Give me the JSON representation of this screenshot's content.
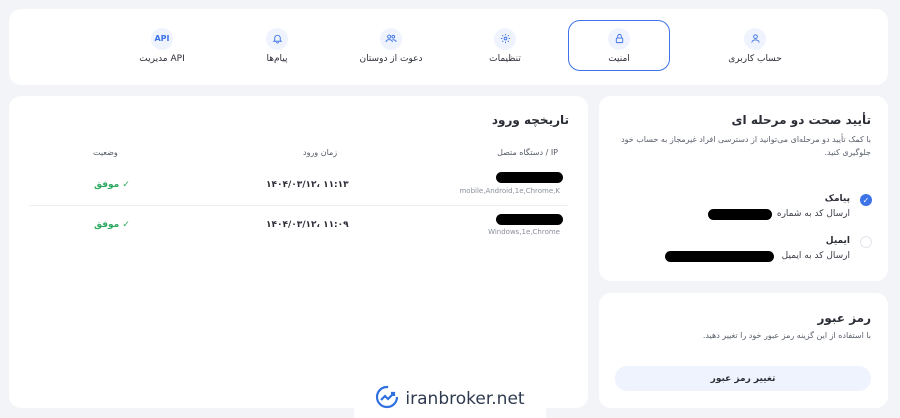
{
  "nav": {
    "tabs": [
      {
        "label": "حساب کاربری",
        "icon": "user-icon",
        "active": false
      },
      {
        "label": "امنیت",
        "icon": "lock-icon",
        "active": true
      },
      {
        "label": "تنظیمات",
        "icon": "gear-icon",
        "active": false
      },
      {
        "label": "دعوت از دوستان",
        "icon": "users-icon",
        "active": false
      },
      {
        "label": "پیام‌ها",
        "icon": "bell-icon",
        "active": false
      },
      {
        "label": "مدیریت API",
        "icon": "api-icon",
        "icon_text": "API",
        "active": false
      }
    ]
  },
  "history": {
    "title": "تاریخچه ورود",
    "columns": {
      "device": "دستگاه متصل / IP",
      "time": "زمان ورود",
      "status": "وضعیت"
    },
    "rows": [
      {
        "device": "mobile,Android,1e,Chrome,K",
        "time": "۱۴۰۴/۰۳/۱۲، ۱۱:۱۳",
        "status": "موفق ✓"
      },
      {
        "device": "Windows,1e,Chrome",
        "time": "۱۴۰۴/۰۳/۱۲، ۱۱:۰۹",
        "status": "موفق ✓"
      }
    ]
  },
  "twofa": {
    "title": "تأیید صحت دو مرحله ای",
    "description": "با کمک تأیید دو مرحله‌ای می‌توانید از دسترسی افراد غیرمجاز به حساب خود جلوگیری کنید.",
    "options": [
      {
        "title": "پیامک",
        "subtitle": "ارسال کد به شماره",
        "selected": true
      },
      {
        "title": "ایمیل",
        "subtitle": "ارسال کد به ایمیل",
        "selected": false
      }
    ]
  },
  "password": {
    "title": "رمز عبور",
    "description": "با استفاده از این گزینه رمز عبور خود را تغییر دهید.",
    "button": "تغییر رمز عبور"
  },
  "watermark": {
    "text": "iranbroker.net"
  },
  "colors": {
    "accent": "#3d73e6",
    "success": "#2aa85f",
    "background": "#f3f4f8"
  }
}
